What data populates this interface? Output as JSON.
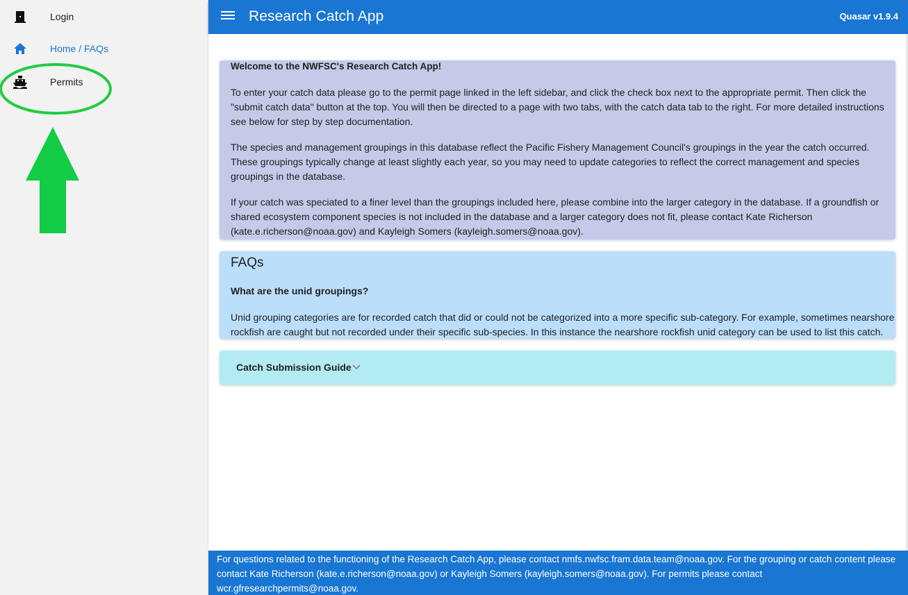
{
  "sidebar": {
    "items": [
      {
        "label": "Login",
        "icon": "door-icon"
      },
      {
        "label": "Home / FAQs",
        "icon": "home-icon"
      },
      {
        "label": "Permits",
        "icon": "boat-icon"
      }
    ]
  },
  "header": {
    "title": "Research Catch App",
    "version": "Quasar v1.9.4"
  },
  "welcome": {
    "title": "Welcome to the NWFSC's Research Catch App!",
    "paragraph1": "To enter your catch data please go to the permit page linked in the left sidebar, and click the check box next to the appropriate permit. Then click the \"submit catch data\" button at the top. You will then be directed to a page with two tabs, with the catch data tab to the right. For more detailed instructions see below for step by step documentation.",
    "paragraph2": "The species and management groupings in this database reflect the Pacific Fishery Management Council's groupings in the year the catch occurred. These groupings typically change at least slightly each year, so you may need to update categories to reflect the correct management and species groupings in the database.",
    "paragraph3": "If your catch was speciated to a finer level than the groupings included here, please combine into the larger category in the database. If a groundfish or shared ecosystem component species is not included in the database and a larger category does not fit, please contact Kate Richerson (kate.e.richerson@noaa.gov) and Kayleigh Somers (kayleigh.somers@noaa.gov)."
  },
  "faqs": {
    "title": "FAQs",
    "question": "What are the unid groupings?",
    "answer": "Unid grouping categories are for recorded catch that did or could not be categorized into a more specific sub-category. For example, sometimes nearshore rockfish are caught but not recorded under their specific sub-species. In this instance the nearshore rockfish unid category can be used to list this catch."
  },
  "guide": {
    "label": "Catch Submission Guide"
  },
  "footer": {
    "text": "For questions related to the functioning of the Research Catch App, please contact nmfs.nwfsc.fram.data.team@noaa.gov. For the grouping or catch content please contact Kate Richerson (kate.e.richerson@noaa.gov) or Kayleigh Somers (kayleigh.somers@noaa.gov). For permits please contact wcr.gfresearchpermits@noaa.gov."
  },
  "colors": {
    "primary": "#1976d2",
    "sidebar_bg": "#f2f2f2",
    "welcome_bg": "#c5cae9",
    "faqs_bg": "#bbdefb",
    "guide_bg": "#b2ebf2",
    "annotation": "#22cc44"
  }
}
